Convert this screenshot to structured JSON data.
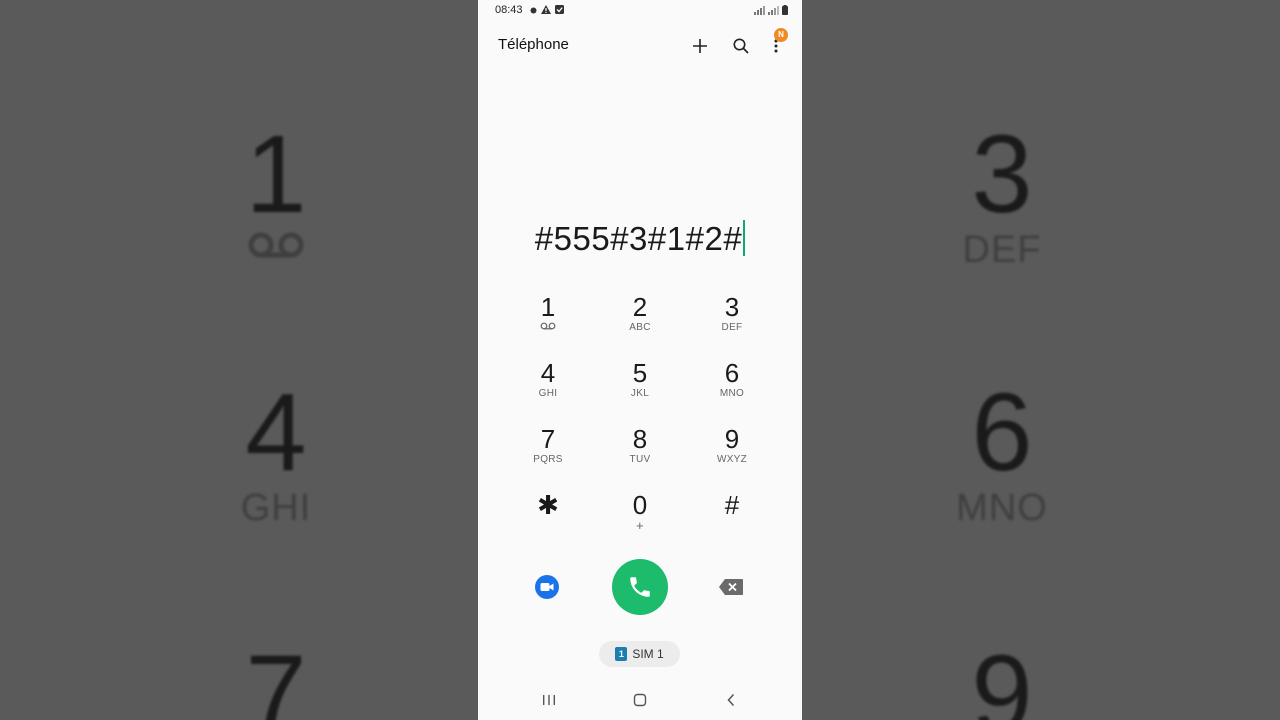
{
  "background": {
    "left_keys": [
      {
        "digit": "1",
        "letters": ""
      },
      {
        "digit": "4",
        "letters": "GHI"
      },
      {
        "digit": "7",
        "letters": ""
      }
    ],
    "right_keys": [
      {
        "digit": "3",
        "letters": "DEF"
      },
      {
        "digit": "6",
        "letters": "MNO"
      },
      {
        "digit": "9",
        "letters": ""
      }
    ]
  },
  "status": {
    "time": "08:43"
  },
  "appbar": {
    "title": "Téléphone",
    "badge": "N"
  },
  "dialer": {
    "number": "#555#3#1#2#"
  },
  "keypad": [
    {
      "digit": "1",
      "letters": ""
    },
    {
      "digit": "2",
      "letters": "ABC"
    },
    {
      "digit": "3",
      "letters": "DEF"
    },
    {
      "digit": "4",
      "letters": "GHI"
    },
    {
      "digit": "5",
      "letters": "JKL"
    },
    {
      "digit": "6",
      "letters": "MNO"
    },
    {
      "digit": "7",
      "letters": "PQRS"
    },
    {
      "digit": "8",
      "letters": "TUV"
    },
    {
      "digit": "9",
      "letters": "WXYZ"
    },
    {
      "digit": "✱",
      "letters": ""
    },
    {
      "digit": "0",
      "letters": "+"
    },
    {
      "digit": "#",
      "letters": ""
    }
  ],
  "sim": {
    "number": "1",
    "label": "SIM 1"
  },
  "colors": {
    "call": "#1dbb6c",
    "video": "#1a73e8",
    "caret": "#14a67a",
    "badge": "#f08a24",
    "sim": "#1a7fb0"
  }
}
